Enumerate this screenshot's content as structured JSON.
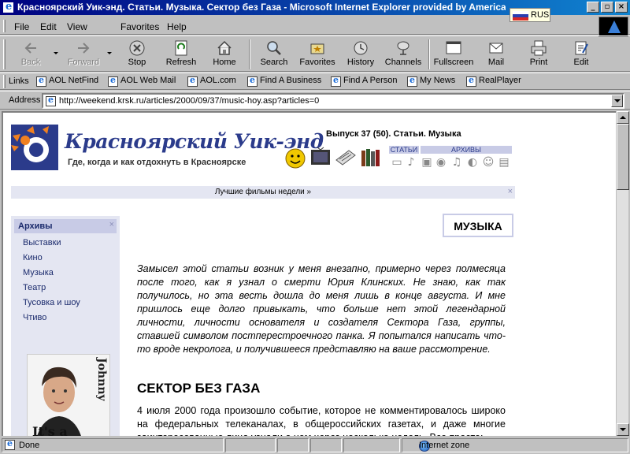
{
  "window": {
    "title": "Красноярский Уик-энд. Статьи. Музыка. Сектор без Газа - Microsoft Internet Explorer provided by America Online",
    "lang": "RUS"
  },
  "menu": [
    "File",
    "Edit",
    "View",
    "Favorites",
    "Help"
  ],
  "toolbar": {
    "back": "Back",
    "forward": "Forward",
    "stop": "Stop",
    "refresh": "Refresh",
    "home": "Home",
    "search": "Search",
    "favorites": "Favorites",
    "history": "History",
    "channels": "Channels",
    "fullscreen": "Fullscreen",
    "mail": "Mail",
    "print": "Print",
    "edit": "Edit"
  },
  "links": {
    "label": "Links",
    "items": [
      "AOL NetFind",
      "AOL Web Mail",
      "AOL.com",
      "Find A Business",
      "Find A Person",
      "My News",
      "RealPlayer"
    ]
  },
  "address": {
    "label": "Address",
    "url": "http://weekend.krsk.ru/articles/2000/09/37/music-hoy.asp?articles=0"
  },
  "site": {
    "logo_title": "Красноярский Уик-энд",
    "logo_subtitle": "Где, когда и как отдохнуть в Красноярске",
    "issue": "Выпуск 37 (50). Статьи. Музыка",
    "tab_articles": "СТАТЬИ",
    "tab_archives": "АРХИВЫ",
    "top_banner": "Лучшие фильмы недели »",
    "close_glyph": "×"
  },
  "sidebar": {
    "heading": "Архивы",
    "items": [
      "Выставки",
      "Кино",
      "Музыка",
      "Театр",
      "Тусовка и шоу",
      "Чтиво"
    ],
    "photo_caption_a": "Johnny",
    "photo_caption_b": "It's a"
  },
  "article": {
    "section": "МУЗЫКА",
    "intro": "Замысел этой статьи возник у меня внезапно, примерно через полмесяца после того, как я узнал о смерти Юрия Клинских. Не знаю, как так получилось, но эта весть дошла до меня лишь в конце августа. И мне пришлось еще долго привыкать, что больше нет этой легендарной личности, личности основателя и создателя Сектора Газа, группы, ставшей символом постперестроечного панка. Я попытался написать что- то вроде некролога, и получившееся представляю на ваше рассмотрение.",
    "heading": "СЕКТОР БЕЗ ГАЗА",
    "body": "4 июля 2000 года произошло событие, которое не комментировалось широко на федеральных телеканалах, в общероссийских газетах, и даже многие заинтересованные лица узнали о нем через несколько недель. Все просто:"
  },
  "status": {
    "text": "Done",
    "zone": "Internet zone"
  }
}
